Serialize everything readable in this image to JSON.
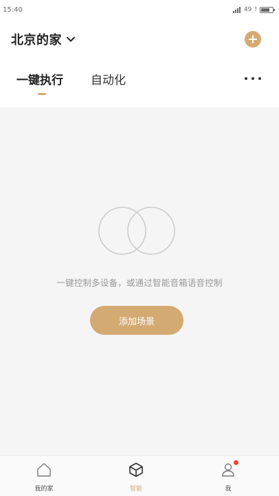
{
  "status_bar": {
    "time": "15:40",
    "network": "49",
    "right_extra": "!"
  },
  "header": {
    "home_name": "北京的家"
  },
  "tabs": [
    {
      "label": "一键执行",
      "active": true
    },
    {
      "label": "自动化",
      "active": false
    }
  ],
  "empty_state": {
    "message": "一键控制多设备，或通过智能音箱语音控制",
    "button_label": "添加场景"
  },
  "bottom_nav": [
    {
      "label": "我的家",
      "icon": "home-icon",
      "active": false
    },
    {
      "label": "智能",
      "icon": "cube-icon",
      "active": true
    },
    {
      "label": "我",
      "icon": "user-icon",
      "active": false,
      "badge": true
    }
  ],
  "colors": {
    "accent": "#d4aa73",
    "background": "#f5f5f5",
    "badge": "#ff3b30"
  }
}
